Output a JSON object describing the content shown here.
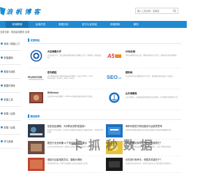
{
  "header": {
    "logo_text": "浪 帆 博 客",
    "search_placeholder": "输入工具名称，如域名"
  },
  "nav": {
    "items": [
      {
        "label": "前端教程"
      },
      {
        "label": "后端开发"
      },
      {
        "label": "数据分析"
      },
      {
        "label": "官方认证网站"
      },
      {
        "label": "前端资料"
      },
      {
        "label": "服务"
      }
    ],
    "active_index": 0
  },
  "breadcrumb": "当前位置：网站建设服务 目录",
  "sidebar": {
    "items": [
      {
        "label": "常用 / 前端入门"
      },
      {
        "label": "前端基础"
      },
      {
        "label": "框架与组件"
      },
      {
        "label": "数据可视化"
      },
      {
        "label": "前端工具"
      },
      {
        "label": "前端 / 后端"
      },
      {
        "label": "前端 / 后端"
      },
      {
        "label": "学习资源"
      }
    ]
  },
  "sections": {
    "sites_title": "优质网站",
    "news_title": "精选推荐"
  },
  "sites": [
    {
      "name": "大连海事大学",
      "desc": "大连海事大学，是交通运输部所属的全国重点大学，国家双一流建设高校。",
      "logo": "seal"
    },
    {
      "name": "A5站长网",
      "desc": "A5站长网是站长交流、网络营销的综合平台，提供站长资讯和教程。",
      "logo": "a5"
    },
    {
      "name": "菜鸟教程",
      "desc": "菜鸟教程提供了编程的基础技术教程，介绍了HTML、CSS、Javascript、Python、Java、Ruby。",
      "logo": "runoob"
    },
    {
      "name": "搜狗网",
      "desc": "专业的SEO技术教程和学习平台，提供网站优化和推广的知识。",
      "logo": "seo"
    },
    {
      "name": "W3School",
      "desc": "领先的Web技术教程，W3School提供全面的前端学习资源。",
      "logo": "w3"
    },
    {
      "name": "山东海事局",
      "desc": "山东海事局，交通运输部海事局的派出机构，负责辖区海事管理工作。",
      "logo": "emblem"
    }
  ],
  "news": [
    {
      "title": "信息如此通畅，为何购买到的是盗版?",
      "desc": "在很多人的认知中，信息的公开透明应该能减少盗版的发生，但现实并非如此。"
    },
    {
      "title": "海事系统官方网站建设与运营的思考",
      "desc": "海事系统的网站建设在信息发布和服务方面发挥着重要作用。"
    },
    {
      "title": "配送行业全网通 以下是全网运营的要点",
      "desc": "在当下的市场环境中，配送行业通过全网运营获得了更多的发展机会。"
    },
    {
      "title": "什么是网站架构？为什么要重视它？",
      "desc": "网站架构是网站建设中的重要组成部分，决定了网站的性能。"
    },
    {
      "title": "谁能与巨星相提并论，旗舰大揭秘",
      "desc": "本文将带你深入了解行业旗舰产品背后的故事与技术。"
    },
    {
      "title": "中的进行竞争中，获胜的关键在于?",
      "desc": "在激烈的市场竞争中，找到合适的方法才是获胜的关键所在。"
    }
  ],
  "watermark": "卡 抓 秒 数 据",
  "colors": {
    "primary": "#1f8ad2",
    "nav_active": "#1674b3",
    "logo": "#0e7ec8"
  }
}
